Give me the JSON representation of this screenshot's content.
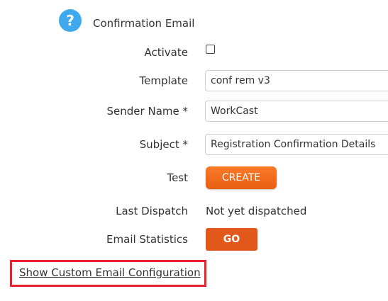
{
  "section": {
    "title": "Confirmation Email",
    "help_icon": "question-mark-icon",
    "help_icon_color": "#3fa9f0",
    "help_symbol": "?"
  },
  "fields": {
    "activate": {
      "label": "Activate",
      "checked": false
    },
    "template": {
      "label": "Template",
      "value": "conf rem v3"
    },
    "sender_name": {
      "label": "Sender Name *",
      "value": "WorkCast"
    },
    "subject": {
      "label": "Subject *",
      "value": "Registration Confirmation Details"
    },
    "test": {
      "label": "Test",
      "button": "CREATE"
    },
    "last_dispatch": {
      "label": "Last Dispatch",
      "value": "Not yet dispatched"
    },
    "email_statistics": {
      "label": "Email Statistics",
      "button": "GO"
    }
  },
  "custom_config": {
    "link": "Show Custom Email Configuration",
    "highlight_color": "#e8222e"
  },
  "colors": {
    "create_button": "#f26c1e",
    "go_button": "#e2571a",
    "text": "#333333"
  }
}
